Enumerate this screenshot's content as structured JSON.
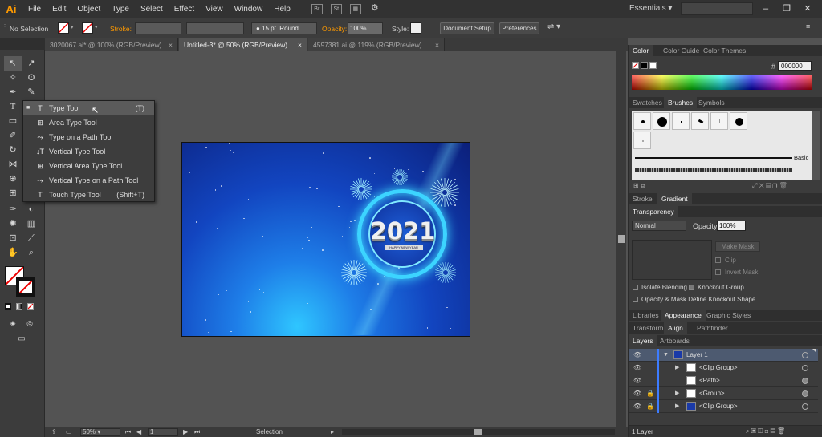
{
  "app": {
    "logo": "Ai"
  },
  "menu": [
    "File",
    "Edit",
    "Object",
    "Type",
    "Select",
    "Effect",
    "View",
    "Window",
    "Help"
  ],
  "menu_icons": {
    "bridge": "Br",
    "stock": "St"
  },
  "workspace": {
    "label": "Essentials ▾"
  },
  "control_bar": {
    "selection_label": "No Selection",
    "stroke_label": "Stroke:",
    "brush_label": "15 pt. Round",
    "opacity_label": "Opacity:",
    "opacity_value": "100%",
    "style_label": "Style:",
    "doc_setup": "Document Setup",
    "preferences": "Preferences"
  },
  "tabs": [
    {
      "label": "3020067.ai* @ 100% (RGB/Preview)",
      "close": "×"
    },
    {
      "label": "Untitled-3* @ 50% (RGB/Preview)",
      "close": "×"
    },
    {
      "label": "4597381.ai @ 119% (RGB/Preview)",
      "close": "×"
    }
  ],
  "flyout": [
    {
      "icon": "T",
      "label": "Type Tool",
      "shortcut": "(T)"
    },
    {
      "icon": "⊞",
      "label": "Area Type Tool",
      "shortcut": ""
    },
    {
      "icon": "⤳",
      "label": "Type on a Path Tool",
      "shortcut": ""
    },
    {
      "icon": "↓T",
      "label": "Vertical Type Tool",
      "shortcut": ""
    },
    {
      "icon": "⊞",
      "label": "Vertical Area Type Tool",
      "shortcut": ""
    },
    {
      "icon": "⤳",
      "label": "Vertical Type on a Path Tool",
      "shortcut": ""
    },
    {
      "icon": "T",
      "label": "Touch Type Tool",
      "shortcut": "(Shift+T)"
    }
  ],
  "artwork": {
    "year": "2021",
    "banner": "HAPPY NEW YEAR"
  },
  "color_panel": {
    "tabs": [
      "Color",
      "Color Guide",
      "Color Themes"
    ],
    "hash": "#",
    "hex": "000000"
  },
  "brushes_panel": {
    "tabs": [
      "Swatches",
      "Brushes",
      "Symbols"
    ],
    "basic": "Basic"
  },
  "stroke_panel": {
    "tabs": [
      "Stroke",
      "Gradient"
    ]
  },
  "transparency": {
    "tab": "Transparency",
    "blend": "Normal",
    "opacity_label": "Opacity:",
    "opacity": "100%",
    "make_mask": "Make Mask",
    "clip": "Clip",
    "invert_mask": "Invert Mask",
    "isolate": "Isolate Blending",
    "knockout": "Knockout Group",
    "opacity_mask": "Opacity & Mask Define Knockout Shape"
  },
  "libraries_tabs": [
    "Libraries",
    "Appearance",
    "Graphic Styles"
  ],
  "transform_tabs": [
    "Transform",
    "Align",
    "Pathfinder"
  ],
  "layers_tabs": [
    "Layers",
    "Artboards"
  ],
  "layers": [
    {
      "name": "Layer 1"
    },
    {
      "name": "<Clip Group>"
    },
    {
      "name": "<Path>"
    },
    {
      "name": "<Group>"
    },
    {
      "name": "<Clip Group>"
    }
  ],
  "layers_footer": "1 Layer",
  "status": {
    "zoom": "50%",
    "page": "1",
    "tool": "Selection"
  }
}
